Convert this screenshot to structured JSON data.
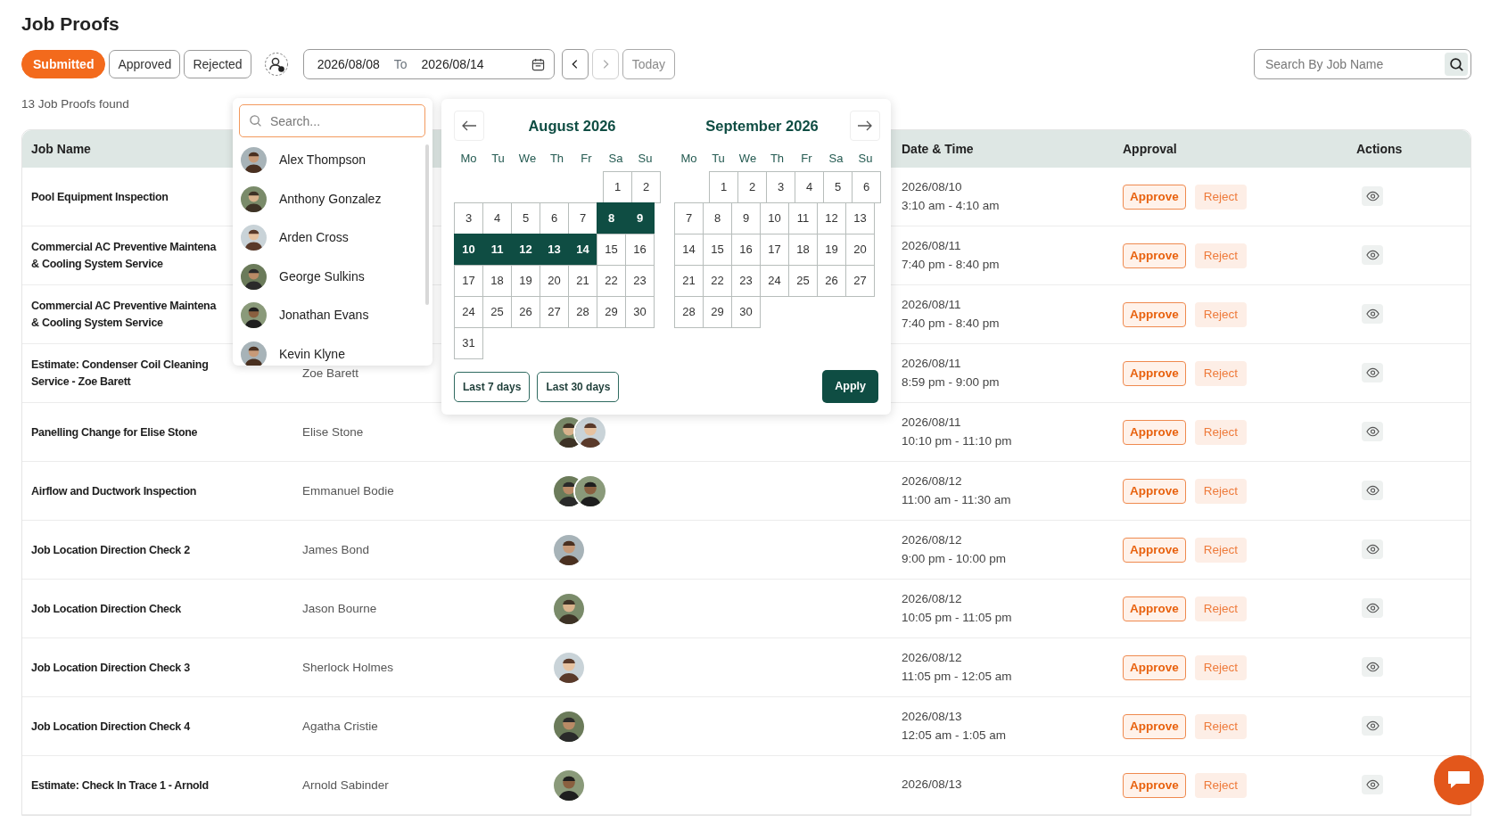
{
  "page": {
    "title": "Job Proofs"
  },
  "status_filters": [
    {
      "label": "Submitted",
      "selected": true
    },
    {
      "label": "Approved",
      "selected": false
    },
    {
      "label": "Rejected",
      "selected": false
    }
  ],
  "date_range": {
    "from": "2026/08/08",
    "separator": "To",
    "to": "2026/08/14"
  },
  "nav_buttons": [
    {
      "kind": "prev",
      "disabled": false
    },
    {
      "kind": "next",
      "disabled": true
    }
  ],
  "today_button": {
    "label": "Today",
    "disabled": true
  },
  "job_search": {
    "placeholder": "Search By Job Name"
  },
  "result_count": "13 Job Proofs found",
  "table": {
    "columns": [
      "Job Name",
      "Date & Time",
      "Approval",
      "Actions"
    ],
    "rows": [
      {
        "job_name": [
          "Pool Equipment Inspection"
        ],
        "date": "2026/08/10",
        "time": "3:10 am - 4:10 am",
        "approve": "Approve",
        "reject": "Reject"
      },
      {
        "job_name": [
          "Commercial AC Preventive Maintena",
          "& Cooling System Service"
        ],
        "date": "2026/08/11",
        "time": "7:40 pm - 8:40 pm",
        "approve": "Approve",
        "reject": "Reject"
      },
      {
        "job_name": [
          "Commercial AC Preventive Maintena",
          "& Cooling System Service"
        ],
        "date": "2026/08/11",
        "time": "7:40 pm - 8:40 pm",
        "approve": "Approve",
        "reject": "Reject"
      },
      {
        "job_name": [
          "Estimate: Condenser Coil Cleaning",
          "Service - Zoe Barett"
        ],
        "column_2": "Zoe Barett",
        "date": "2026/08/11",
        "time": "8:59 pm - 9:00 pm",
        "approve": "Approve",
        "reject": "Reject"
      },
      {
        "job_name": [
          "Panelling Change for Elise Stone"
        ],
        "column_2": "Elise Stone",
        "column_3": [
          {
            "kind": "picture"
          },
          {
            "kind": "picture"
          }
        ],
        "date": "2026/08/11",
        "time": "10:10 pm - 11:10 pm",
        "approve": "Approve",
        "reject": "Reject"
      },
      {
        "job_name": [
          "Airflow and Ductwork Inspection"
        ],
        "column_2": "Emmanuel Bodie",
        "column_3": [
          {
            "kind": "picture"
          },
          {
            "kind": "picture"
          }
        ],
        "date": "2026/08/12",
        "time": "11:00 am - 11:30 am",
        "approve": "Approve",
        "reject": "Reject"
      },
      {
        "job_name": [
          "Job Location Direction Check 2"
        ],
        "column_2": "James Bond",
        "column_3": [
          {
            "kind": "picture"
          }
        ],
        "date": "2026/08/12",
        "time": "9:00 pm - 10:00 pm",
        "approve": "Approve",
        "reject": "Reject"
      },
      {
        "job_name": [
          "Job Location Direction Check"
        ],
        "column_2": "Jason Bourne",
        "column_3": [
          {
            "kind": "picture"
          }
        ],
        "date": "2026/08/12",
        "time": "10:05 pm - 11:05 pm",
        "approve": "Approve",
        "reject": "Reject"
      },
      {
        "job_name": [
          "Job Location Direction Check 3"
        ],
        "column_2": "Sherlock Holmes",
        "column_3": [
          {
            "kind": "picture"
          }
        ],
        "date": "2026/08/12",
        "time": "11:05 pm - 12:05 am",
        "approve": "Approve",
        "reject": "Reject"
      },
      {
        "job_name": [
          "Job Location Direction Check 4"
        ],
        "column_2": "Agatha Cristie",
        "column_3": [
          {
            "kind": "picture"
          }
        ],
        "date": "2026/08/13",
        "time": "12:05 am - 1:05 am",
        "approve": "Approve",
        "reject": "Reject"
      },
      {
        "job_name": [
          "Estimate: Check In Trace 1 - Arnold"
        ],
        "column_2": "Arnold Sabinder",
        "column_3": [
          {
            "kind": "picture"
          }
        ],
        "date": "2026/08/13",
        "approve": "Approve",
        "reject": "Reject"
      }
    ]
  },
  "people_dropdown": {
    "placeholder": "Search...",
    "people": [
      {
        "name": "Alex Thompson"
      },
      {
        "name": "Anthony Gonzalez"
      },
      {
        "name": "Arden Cross"
      },
      {
        "name": "George Sulkins"
      },
      {
        "name": "Jonathan Evans"
      },
      {
        "name": "Kevin Klyne"
      }
    ]
  },
  "calendar": {
    "months": [
      {
        "title": "August 2026",
        "weekdays": [
          "Mo",
          "Tu",
          "We",
          "Th",
          "Fr",
          "Sa",
          "Su"
        ],
        "weeks": [
          {
            "kind": "first",
            "days": [
              {
                "day": "1",
                "selected": false
              },
              {
                "day": "2",
                "selected": false
              }
            ]
          },
          {
            "kind": "full",
            "days": [
              {
                "day": "3",
                "selected": false
              },
              {
                "day": "4",
                "selected": false
              },
              {
                "day": "5",
                "selected": false
              },
              {
                "day": "6",
                "selected": false
              },
              {
                "day": "7",
                "selected": false
              },
              {
                "day": "8",
                "selected": true
              },
              {
                "day": "9",
                "selected": true
              }
            ]
          },
          {
            "kind": "full",
            "days": [
              {
                "day": "10",
                "selected": true
              },
              {
                "day": "11",
                "selected": true
              },
              {
                "day": "12",
                "selected": true
              },
              {
                "day": "13",
                "selected": true
              },
              {
                "day": "14",
                "selected": true
              },
              {
                "day": "15",
                "selected": false
              },
              {
                "day": "16",
                "selected": false
              }
            ]
          },
          {
            "kind": "full",
            "days": [
              {
                "day": "17",
                "selected": false
              },
              {
                "day": "18",
                "selected": false
              },
              {
                "day": "19",
                "selected": false
              },
              {
                "day": "20",
                "selected": false
              },
              {
                "day": "21",
                "selected": false
              },
              {
                "day": "22",
                "selected": false
              },
              {
                "day": "23",
                "selected": false
              }
            ]
          },
          {
            "kind": "full",
            "days": [
              {
                "day": "24",
                "selected": false
              },
              {
                "day": "25",
                "selected": false
              },
              {
                "day": "26",
                "selected": false
              },
              {
                "day": "27",
                "selected": false
              },
              {
                "day": "28",
                "selected": false
              },
              {
                "day": "29",
                "selected": false
              },
              {
                "day": "30",
                "selected": false
              }
            ]
          },
          {
            "kind": "last",
            "days": [
              {
                "day": "31",
                "selected": false
              }
            ]
          }
        ]
      },
      {
        "title": "September 2026",
        "weekdays": [
          "Mo",
          "Tu",
          "We",
          "Th",
          "Fr",
          "Sa",
          "Su"
        ],
        "weeks": [
          {
            "kind": "first",
            "days": [
              {
                "day": "1",
                "selected": false
              },
              {
                "day": "2",
                "selected": false
              },
              {
                "day": "3",
                "selected": false
              },
              {
                "day": "4",
                "selected": false
              },
              {
                "day": "5",
                "selected": false
              },
              {
                "day": "6",
                "selected": false
              }
            ]
          },
          {
            "kind": "full",
            "days": [
              {
                "day": "7",
                "selected": false
              },
              {
                "day": "8",
                "selected": false
              },
              {
                "day": "9",
                "selected": false
              },
              {
                "day": "10",
                "selected": false
              },
              {
                "day": "11",
                "selected": false
              },
              {
                "day": "12",
                "selected": false
              },
              {
                "day": "13",
                "selected": false
              }
            ]
          },
          {
            "kind": "full",
            "days": [
              {
                "day": "14",
                "selected": false
              },
              {
                "day": "15",
                "selected": false
              },
              {
                "day": "16",
                "selected": false
              },
              {
                "day": "17",
                "selected": false
              },
              {
                "day": "18",
                "selected": false
              },
              {
                "day": "19",
                "selected": false
              },
              {
                "day": "20",
                "selected": false
              }
            ]
          },
          {
            "kind": "full",
            "days": [
              {
                "day": "21",
                "selected": false
              },
              {
                "day": "22",
                "selected": false
              },
              {
                "day": "23",
                "selected": false
              },
              {
                "day": "24",
                "selected": false
              },
              {
                "day": "25",
                "selected": false
              },
              {
                "day": "26",
                "selected": false
              },
              {
                "day": "27",
                "selected": false
              }
            ]
          },
          {
            "kind": "last",
            "days": [
              {
                "day": "28",
                "selected": false
              },
              {
                "day": "29",
                "selected": false
              },
              {
                "day": "30",
                "selected": false
              }
            ]
          }
        ]
      }
    ],
    "presets": [
      "Last 7 days",
      "Last 30 days"
    ],
    "apply": "Apply"
  }
}
